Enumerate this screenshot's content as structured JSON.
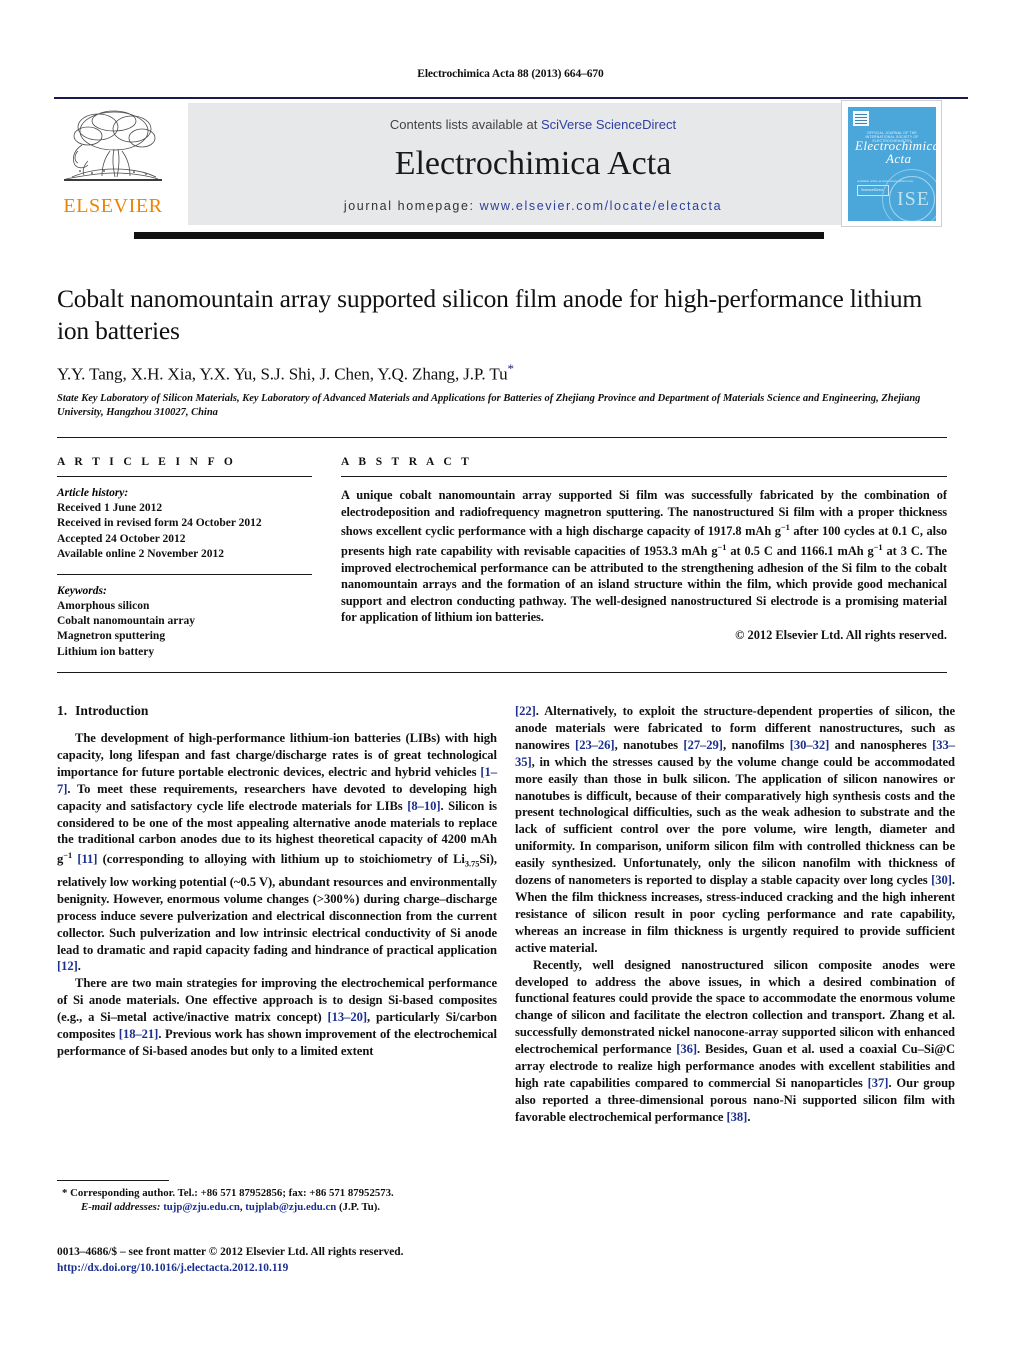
{
  "running_head": "Electrochimica Acta 88 (2013) 664–670",
  "masthead": {
    "contents_prefix": "Contents lists available at ",
    "contents_link": "SciVerse ScienceDirect",
    "journal_name": "Electrochimica Acta",
    "homepage_prefix": "journal homepage: ",
    "homepage_url": "www.elsevier.com/locate/electacta",
    "publisher_logo_text": "ELSEVIER",
    "cover": {
      "society_line": "OFFICIAL JOURNAL OF THE INTERNATIONAL SOCIETY OF ELECTROCHEMISTRY",
      "title_line1": "Electrochimica",
      "title_line2": "Acta",
      "box_label": "ScienceDirect",
      "small_text": "Available online at www.sciencedirect.com",
      "seal_text": "ISE",
      "bg_color": "#4ba7da"
    }
  },
  "article": {
    "title": "Cobalt nanomountain array supported silicon film anode for high-performance lithium ion batteries",
    "authors": "Y.Y. Tang, X.H. Xia, Y.X. Yu, S.J. Shi, J. Chen, Y.Q. Zhang, J.P. Tu",
    "corresponding_marker": "*",
    "affiliation": "State Key Laboratory of Silicon Materials, Key Laboratory of Advanced Materials and Applications for Batteries of Zhejiang Province and Department of Materials Science and Engineering, Zhejiang University, Hangzhou 310027, China"
  },
  "article_info": {
    "heading": "A R T I C L E   I N F O",
    "history_label": "Article history:",
    "history": [
      "Received 1 June 2012",
      "Received in revised form 24 October 2012",
      "Accepted 24 October 2012",
      "Available online 2 November 2012"
    ],
    "keywords_label": "Keywords:",
    "keywords": [
      "Amorphous silicon",
      "Cobalt nanomountain array",
      "Magnetron sputtering",
      "Lithium ion battery"
    ]
  },
  "abstract": {
    "heading": "A B S T R A C T",
    "paragraph_1": "A unique cobalt nanomountain array supported Si film was successfully fabricated by the combination of electrodeposition and radiofrequency magnetron sputtering. The nanostructured Si film with a proper thickness shows excellent cyclic performance with a high discharge capacity of 1917.8 mAh g",
    "paragraph_2": " after 100 cycles at 0.1 C, also presents high rate capability with revisable capacities of 1953.3 mAh g",
    "paragraph_3": " at 0.5 C and 1166.1 mAh g",
    "paragraph_4": " at 3 C. The improved electrochemical performance can be attributed to the strengthening adhesion of the Si film to the cobalt nanomountain arrays and the formation of an island structure within the film, which provide good mechanical support and electron conducting pathway. The well-designed nanostructured Si electrode is a promising material for application of lithium ion batteries.",
    "superscript": "−1",
    "copyright": "© 2012 Elsevier Ltd. All rights reserved."
  },
  "body": {
    "section_number": "1.",
    "section_title": "Introduction",
    "left": {
      "p1_a": "The development of high-performance lithium-ion batteries (LIBs) with high capacity, long lifespan and fast charge/discharge rates is of great technological importance for future portable electronic devices, electric and hybrid vehicles ",
      "p1_ref1": "[1–7]",
      "p1_b": ". To meet these requirements, researchers have devoted to developing high capacity and satisfactory cycle life electrode materials for LIBs ",
      "p1_ref2": "[8–10]",
      "p1_c": ". Silicon is considered to be one of the most appealing alternative anode materials to replace the traditional carbon anodes due to its highest theoretical capacity of 4200 mAh g",
      "p1_sup": "−1",
      "p1_ref3": "[11]",
      "p1_d": " (corresponding to alloying with lithium up to stoichiometry of Li",
      "p1_sub": "3.75",
      "p1_e": "Si), relatively low working potential (~0.5 V), abundant resources and environmentally benignity. However, enormous volume changes (>300%) during charge–discharge process induce severe pulverization and electrical disconnection from the current collector. Such pulverization and low intrinsic electrical conductivity of Si anode lead to dramatic and rapid capacity fading and hindrance of practical application ",
      "p1_ref4": "[12]",
      "p1_f": ".",
      "p2_a": "There are two main strategies for improving the electrochemical performance of Si anode materials. One effective approach is to design Si-based composites (e.g., a Si–metal active/inactive matrix concept) ",
      "p2_ref1": "[13–20]",
      "p2_b": ", particularly Si/carbon composites ",
      "p2_ref2": "[18–21]",
      "p2_c": ". Previous work has shown improvement of the electrochemical performance of Si-based anodes but only to a limited extent"
    },
    "right": {
      "p2_cont_ref": "[22]",
      "p2_cont": ". Alternatively, to exploit the structure-dependent properties of silicon, the anode materials were fabricated to form different nanostructures, such as nanowires ",
      "p2_ref3": "[23–26]",
      "p2_d": ", nanotubes ",
      "p2_ref4": "[27–29]",
      "p2_e": ", nanofilms ",
      "p2_ref5": "[30–32]",
      "p2_f": " and nanospheres ",
      "p2_ref6": "[33–35]",
      "p2_g": ", in which the stresses caused by the volume change could be accommodated more easily than those in bulk silicon. The application of silicon nanowires or nanotubes is difficult, because of their comparatively high synthesis costs and the present technological difficulties, such as the weak adhesion to substrate and the lack of sufficient control over the pore volume, wire length, diameter and uniformity. In comparison, uniform silicon film with controlled thickness can be easily synthesized. Unfortunately, only the silicon nanofilm with thickness of dozens of nanometers is reported to display a stable capacity over long cycles ",
      "p2_ref7": "[30]",
      "p2_h": ". When the film thickness increases, stress-induced cracking and the high inherent resistance of silicon result in poor cycling performance and rate capability, whereas an increase in film thickness is urgently required to provide sufficient active material.",
      "p3_a": "Recently, well designed nanostructured silicon composite anodes were developed to address the above issues, in which a desired combination of functional features could provide the space to accommodate the enormous volume change of silicon and facilitate the electron collection and transport. Zhang et al. successfully demonstrated nickel nanocone-array supported silicon with enhanced electrochemical performance ",
      "p3_ref1": "[36]",
      "p3_b": ". Besides, Guan et al. used a coaxial Cu–Si@C array electrode to realize high performance anodes with excellent stabilities and high rate capabilities compared to commercial Si nanoparticles ",
      "p3_ref2": "[37]",
      "p3_c": ". Our group also reported a three-dimensional porous nano-Ni supported silicon film with favorable electrochemical performance ",
      "p3_ref3": "[38]",
      "p3_d": "."
    }
  },
  "footnotes": {
    "corresponding": "* Corresponding author. Tel.: +86 571 87952856; fax: +86 571 87952573.",
    "email_label": "E-mail addresses:",
    "email_1": "tujp@zju.edu.cn",
    "email_2": "tujplab@zju.edu.cn",
    "email_suffix": "(J.P. Tu).",
    "issn_line": "0013–4686/$ – see front matter © 2012 Elsevier Ltd. All rights reserved.",
    "doi_line": "http://dx.doi.org/10.1016/j.electacta.2012.10.119"
  }
}
